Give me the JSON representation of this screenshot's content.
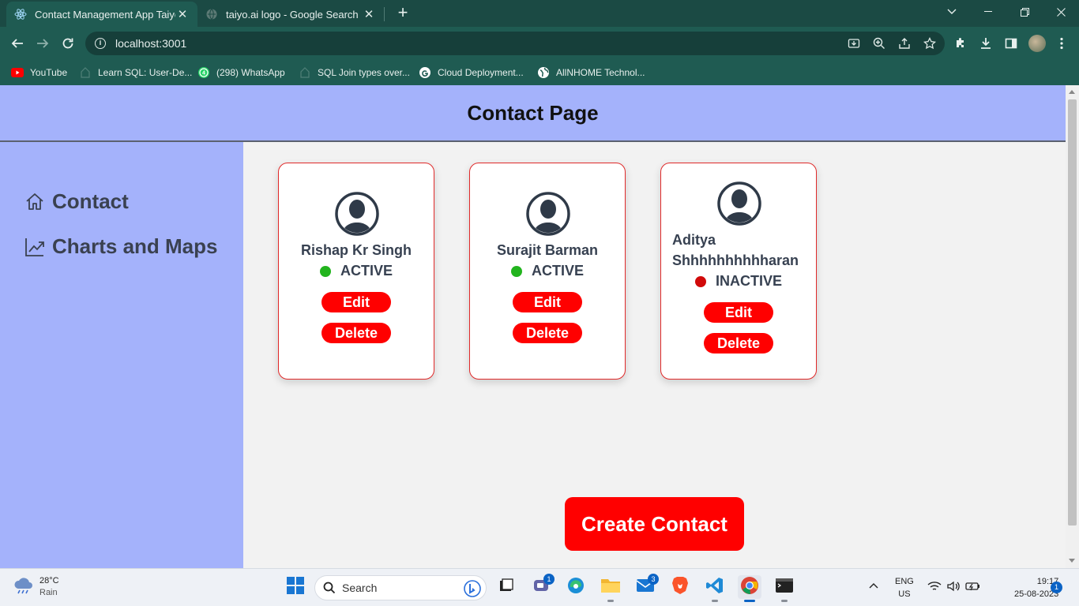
{
  "browser": {
    "tabs": [
      {
        "title": "Contact Management App Taiyo",
        "active": true
      },
      {
        "title": "taiyo.ai logo - Google Search",
        "active": false
      }
    ],
    "url": "localhost:3001",
    "bookmarks": [
      {
        "label": "YouTube",
        "icon": "youtube-icon"
      },
      {
        "label": "Learn SQL: User-De...",
        "icon": "bookmark-icon"
      },
      {
        "label": "(298) WhatsApp",
        "icon": "whatsapp-icon"
      },
      {
        "label": "SQL Join types over...",
        "icon": "bookmark-icon"
      },
      {
        "label": "Cloud Deployment...",
        "icon": "google-icon"
      },
      {
        "label": "AllNHOME Technol...",
        "icon": "globe-icon"
      }
    ]
  },
  "app": {
    "header_title": "Contact Page",
    "sidebar": {
      "items": [
        {
          "label": "Contact",
          "icon": "home-icon"
        },
        {
          "label": "Charts and Maps",
          "icon": "chart-line-icon"
        }
      ]
    },
    "contacts": [
      {
        "name": "Rishap Kr Singh",
        "status": "ACTIVE",
        "status_color": "#22b41e"
      },
      {
        "name": "Surajit Barman",
        "status": "ACTIVE",
        "status_color": "#22b41e"
      },
      {
        "name_line1": "Aditya",
        "name_line2": "Shhhhhhhhhharan",
        "status": "INACTIVE",
        "status_color": "#d10a0a"
      }
    ],
    "edit_label": "Edit",
    "delete_label": "Delete",
    "create_label": "Create Contact"
  },
  "taskbar": {
    "temperature": "28°C",
    "weather": "Rain",
    "search_placeholder": "Search",
    "lang_1": "ENG",
    "lang_2": "US",
    "time": "19:17",
    "date": "25-08-2023",
    "notification_count": "1",
    "teams_badge": "1",
    "mail_badge": "3"
  },
  "colors": {
    "accent_red": "#ff0000",
    "header_bg": "#a4b2fb",
    "chrome_green": "#1f5b52"
  }
}
